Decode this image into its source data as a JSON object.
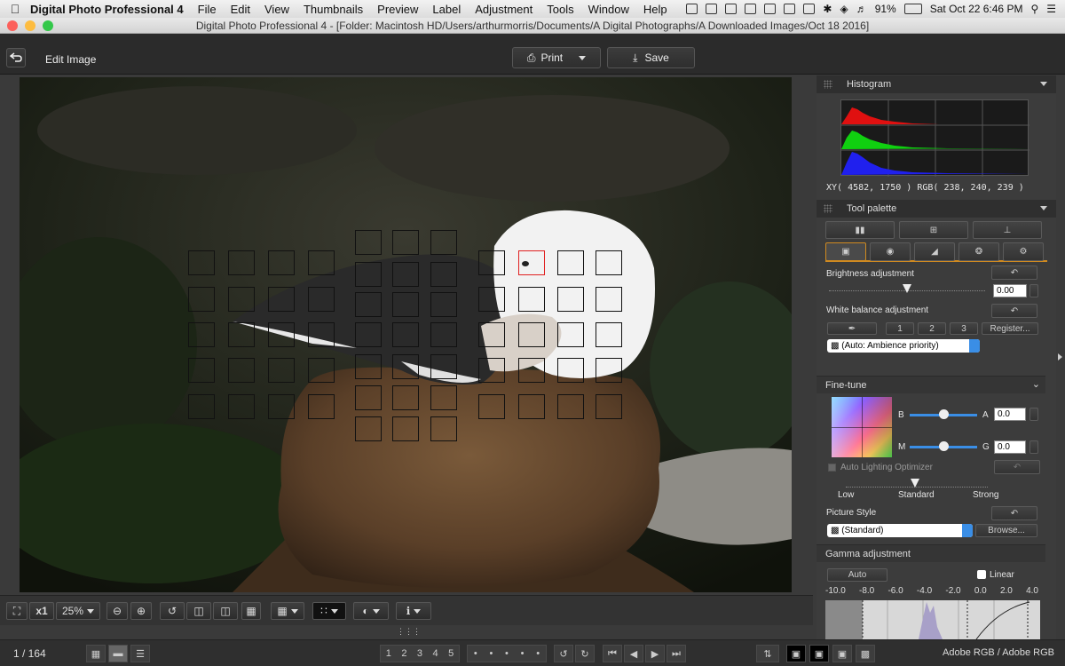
{
  "menubar": {
    "app_name": "Digital Photo Professional 4",
    "items": [
      "File",
      "Edit",
      "View",
      "Thumbnails",
      "Preview",
      "Label",
      "Adjustment",
      "Tools",
      "Window",
      "Help"
    ],
    "battery": "91%",
    "datetime": "Sat Oct 22  6:46 PM"
  },
  "window": {
    "title": "Digital Photo Professional 4 - [Folder: Macintosh HD/Users/arthurmorris/Documents/A Digital Photographs/A Downloaded Images/Oct 18 2016]"
  },
  "toolbar": {
    "edit_image": "Edit Image",
    "print": "Print",
    "save": "Save"
  },
  "histogram": {
    "title": "Histogram",
    "readout": "XY(  4582,   1750 ) RGB( 238,  240,  239 )"
  },
  "tool_palette": {
    "title": "Tool palette",
    "brightness_label": "Brightness adjustment",
    "brightness_value": "0.00",
    "brightness_level": 0.5,
    "wb_label": "White balance adjustment",
    "wb_presets": [
      "1",
      "2",
      "3"
    ],
    "register": "Register...",
    "wb_mode": "(Auto: Ambience priority)",
    "finetune_title": "Fine-tune",
    "b_label": "B",
    "a_label": "A",
    "a_value": "0.0",
    "m_label": "M",
    "g_label": "G",
    "g_value": "0.0",
    "alo_label": "Auto Lighting Optimizer",
    "alo_low": "Low",
    "alo_standard": "Standard",
    "alo_strong": "Strong",
    "ps_label": "Picture Style",
    "ps_value": "(Standard)",
    "browse": "Browse...",
    "gamma_title": "Gamma adjustment",
    "auto": "Auto",
    "linear": "Linear",
    "gamma_ticks": [
      "-10.0",
      "-8.0",
      "-6.0",
      "-4.0",
      "-2.0",
      "0.0",
      "2.0",
      "4.0"
    ]
  },
  "bottom": {
    "zoom_x1": "x1",
    "zoom_pct": "25%",
    "page_counter": "1 / 164",
    "ratings": [
      "1",
      "2",
      "3",
      "4",
      "5"
    ],
    "color_space": "Adobe RGB / Adobe RGB"
  }
}
